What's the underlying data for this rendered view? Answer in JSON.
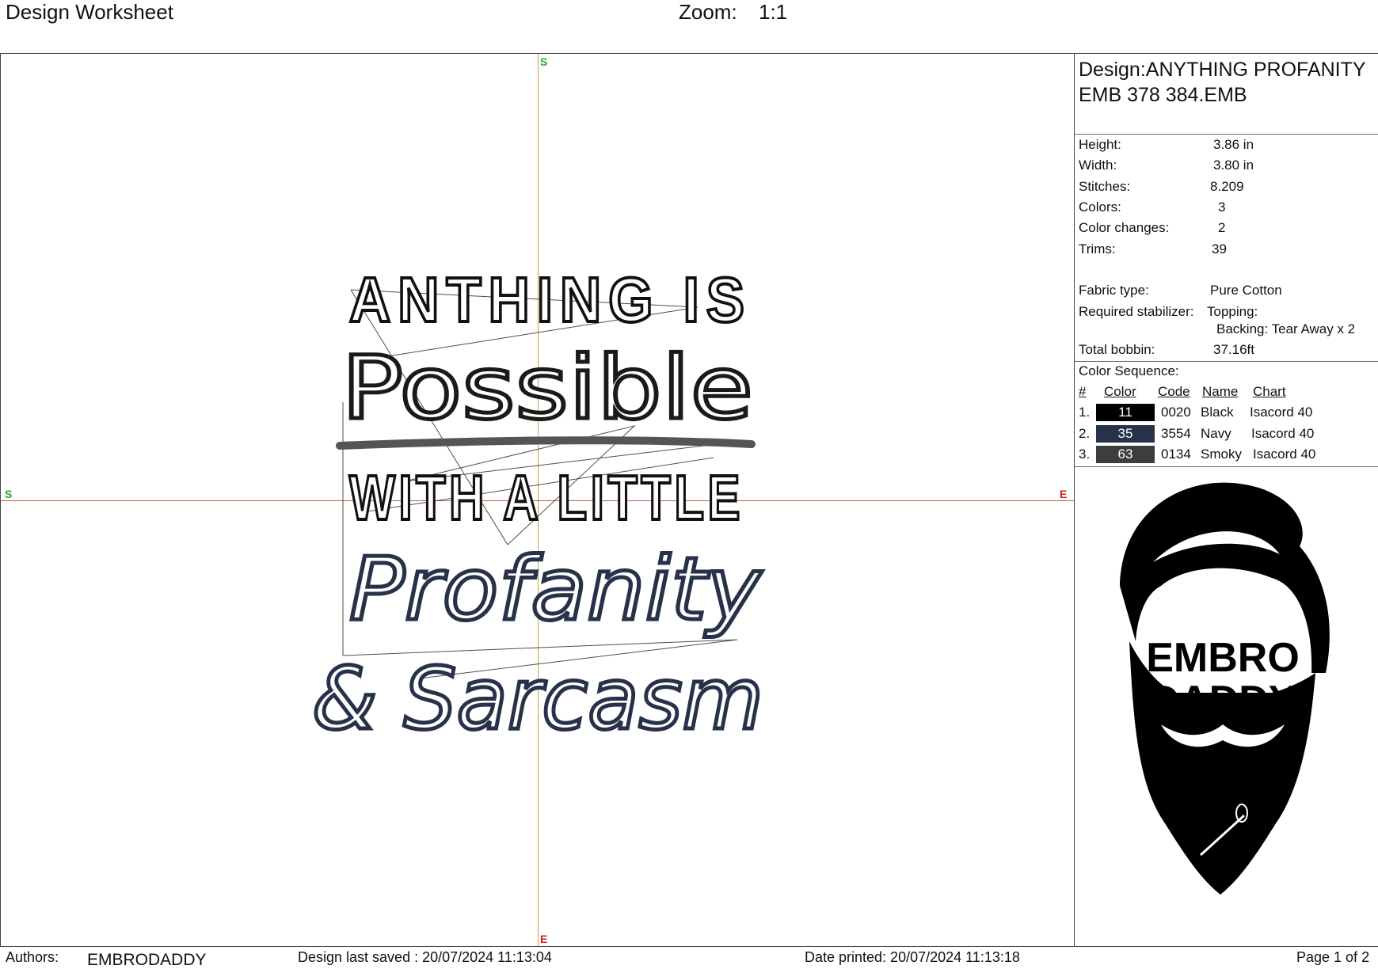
{
  "header": {
    "title": "Design Worksheet",
    "zoom_label": "Zoom:",
    "zoom_value": "1:1"
  },
  "axes": {
    "start_marker": "S",
    "end_marker": "E"
  },
  "design_text": {
    "line1": "ANTHING IS",
    "line2": "Possible",
    "line3": "WITH A LITTLE",
    "line4": "Profanity",
    "line5": "& Sarcasm"
  },
  "panel": {
    "design_title": "Design:ANYTHING PROFANITY EMB 378 384.EMB",
    "stats": [
      {
        "label": "Height:",
        "value": "3.86 in"
      },
      {
        "label": "Width:",
        "value": "3.80 in"
      },
      {
        "label": "Stitches:",
        "value": "8.209"
      },
      {
        "label": "Colors:",
        "value": "3"
      },
      {
        "label": "Color changes:",
        "value": "2"
      },
      {
        "label": "Trims:",
        "value": "39"
      }
    ],
    "fabric_label": "Fabric type:",
    "fabric_value": "Pure Cotton",
    "stabilizer_label": "Required stabilizer:",
    "topping_label": "Topping:",
    "backing_label": "Backing: Tear Away x 2",
    "bobbin_label": "Total bobbin:",
    "bobbin_value": "37.16ft",
    "color_seq_title": "Color Sequence:",
    "columns": [
      "#",
      "Color",
      "Code",
      "Name",
      "Chart"
    ],
    "colors": [
      {
        "num": "1.",
        "color_no": "11",
        "code": "0020",
        "name": "Black",
        "chart": "Isacord 40",
        "hex": "#000000"
      },
      {
        "num": "2.",
        "color_no": "35",
        "code": "3554",
        "name": "Navy",
        "chart": "Isacord 40",
        "hex": "#27324a"
      },
      {
        "num": "3.",
        "color_no": "63",
        "code": "0134",
        "name": "Smoky",
        "chart": "Isacord 40",
        "hex": "#3d3d3d"
      }
    ],
    "logo_line1": "EMBRO",
    "logo_line2": "DADDY"
  },
  "footer": {
    "authors_label": "Authors:",
    "authors_value": "EMBRODADDY",
    "saved": "Design last saved : 20/07/2024 11:13:04",
    "printed": "Date printed: 20/07/2024 11:13:18",
    "page": "Page 1 of 2"
  }
}
